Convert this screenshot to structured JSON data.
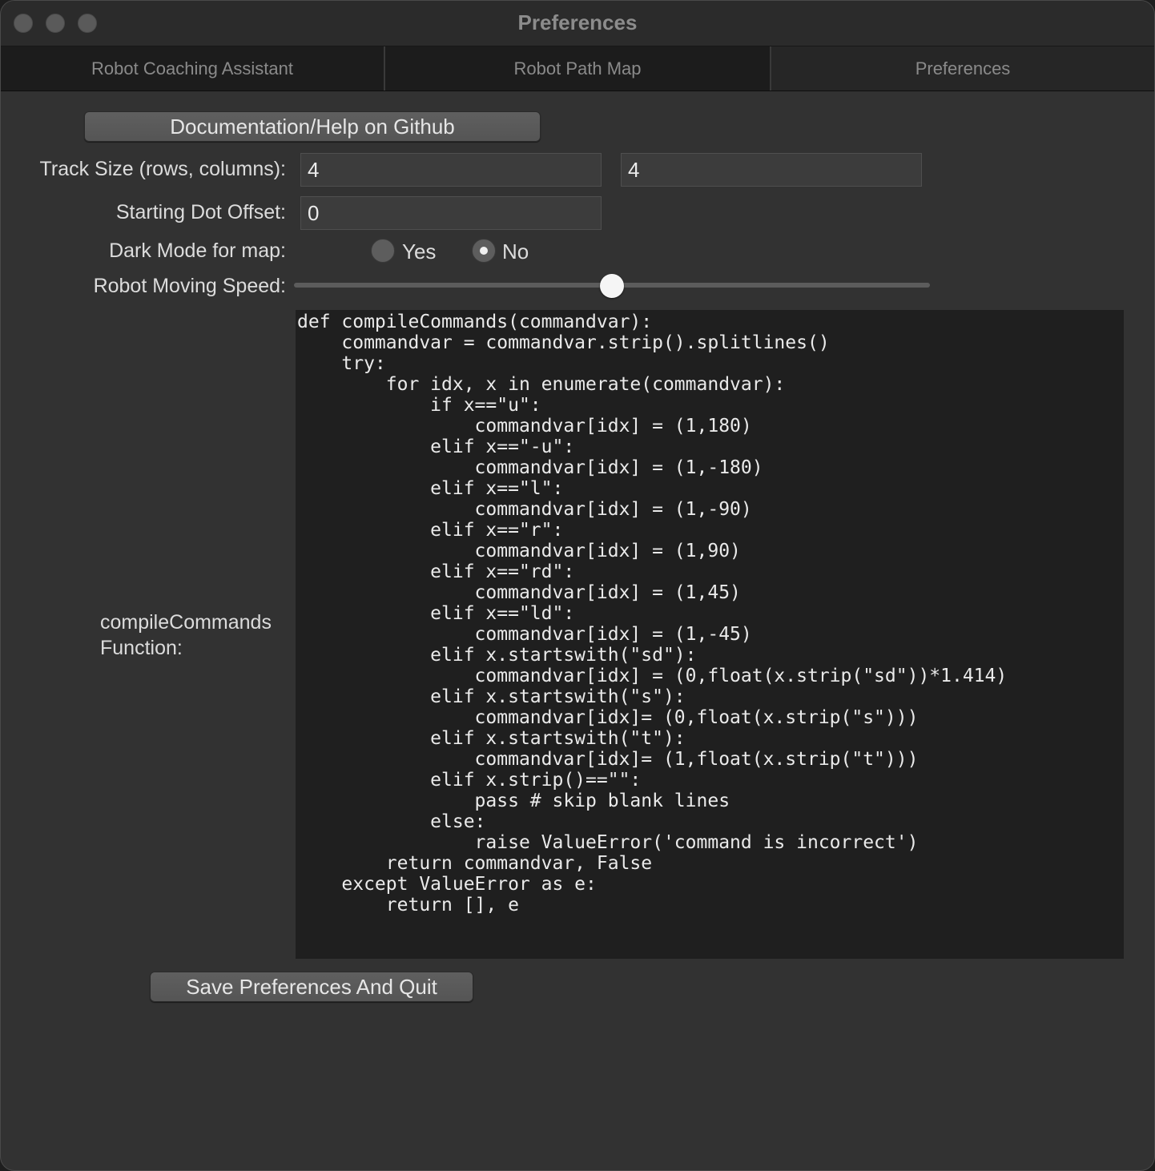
{
  "window": {
    "title": "Preferences"
  },
  "tabs": [
    {
      "label": "Robot Coaching Assistant"
    },
    {
      "label": "Robot Path Map"
    },
    {
      "label": "Preferences"
    }
  ],
  "buttons": {
    "docs_label": "Documentation/Help on Github",
    "save_label": "Save Preferences And Quit"
  },
  "track_size": {
    "label": "Track Size (rows, columns):",
    "rows": "4",
    "columns": "4"
  },
  "starting_dot_offset": {
    "label": "Starting Dot Offset:",
    "value": "0"
  },
  "dark_mode": {
    "label": "Dark Mode for map:",
    "option_yes": "Yes",
    "option_no": "No",
    "selected": "No"
  },
  "speed": {
    "label": "Robot Moving Speed:",
    "value_fraction": 0.5
  },
  "compile_function": {
    "label_line1": "compileCommands",
    "label_line2": "Function:",
    "code": "def compileCommands(commandvar):\n    commandvar = commandvar.strip().splitlines()\n    try:\n        for idx, x in enumerate(commandvar):\n            if x==\"u\":\n                commandvar[idx] = (1,180)\n            elif x==\"-u\":\n                commandvar[idx] = (1,-180)\n            elif x==\"l\":\n                commandvar[idx] = (1,-90)\n            elif x==\"r\":\n                commandvar[idx] = (1,90)\n            elif x==\"rd\":\n                commandvar[idx] = (1,45)\n            elif x==\"ld\":\n                commandvar[idx] = (1,-45)\n            elif x.startswith(\"sd\"):\n                commandvar[idx] = (0,float(x.strip(\"sd\"))*1.414)\n            elif x.startswith(\"s\"):\n                commandvar[idx]= (0,float(x.strip(\"s\")))\n            elif x.startswith(\"t\"):\n                commandvar[idx]= (1,float(x.strip(\"t\")))\n            elif x.strip()==\"\":\n                pass # skip blank lines\n            else:\n                raise ValueError('command is incorrect')\n        return commandvar, False\n    except ValueError as e:\n        return [], e"
  }
}
